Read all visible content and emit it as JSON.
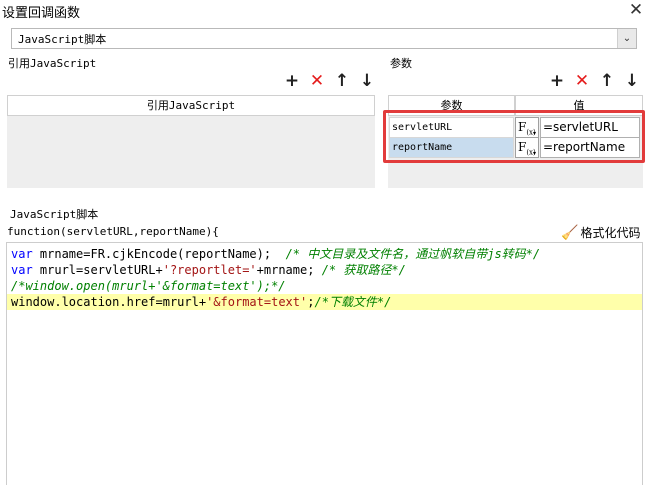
{
  "window": {
    "title": "设置回调函数",
    "close_glyph": "✕"
  },
  "callback_type": {
    "selected": "JavaScript脚本",
    "arrow_glyph": "⌄"
  },
  "js_section": {
    "label": "引用JavaScript",
    "toolbar": {
      "add": "+",
      "delete": "✕",
      "up": "↑",
      "down": "↓"
    },
    "column_header": "引用JavaScript"
  },
  "params_section": {
    "label": "参数",
    "toolbar": {
      "add": "+",
      "delete": "✕",
      "up": "↑",
      "down": "↓"
    },
    "columns": [
      "参数",
      "值"
    ],
    "rows": [
      {
        "name": "servletURL",
        "value": "=servletURL",
        "selected": false
      },
      {
        "name": "reportName",
        "value": "=reportName",
        "selected": true
      }
    ],
    "highlight_color": "#e23b3b"
  },
  "script_section": {
    "label": "JavaScript脚本",
    "signature": "function(servletURL,reportName){",
    "format_label": "格式化代码",
    "format_icon_glyph": "🧹",
    "lines": [
      [
        [
          "kw",
          "var"
        ],
        [
          "t",
          " mrname=FR.cjkEncode(reportName);  "
        ],
        [
          "cm",
          "/* 中文目录及文件名，通过帆软自带js转码*/"
        ]
      ],
      [
        [
          "kw",
          "var"
        ],
        [
          "t",
          " mrurl=servletURL+"
        ],
        [
          "str",
          "'?reportlet='"
        ],
        [
          "t",
          "+mrname; "
        ],
        [
          "cm",
          "/* 获取路径*/"
        ]
      ],
      [
        [
          "cm",
          "/*window.open(mrurl+'&format=text');*/"
        ]
      ],
      [
        [
          "t",
          "window.location.href=mrurl+"
        ],
        [
          "str",
          "'&format=text'"
        ],
        [
          "t",
          ";"
        ],
        [
          "cm",
          "/*下载文件*/"
        ]
      ]
    ],
    "highlighted_line": 3
  },
  "colors": {
    "keyword": "#0000ff",
    "string": "#a31515",
    "comment": "#008000",
    "line_highlight": "#ffffaa",
    "selected_row": "#c8dcee",
    "delete_icon": "#e51b1b"
  }
}
